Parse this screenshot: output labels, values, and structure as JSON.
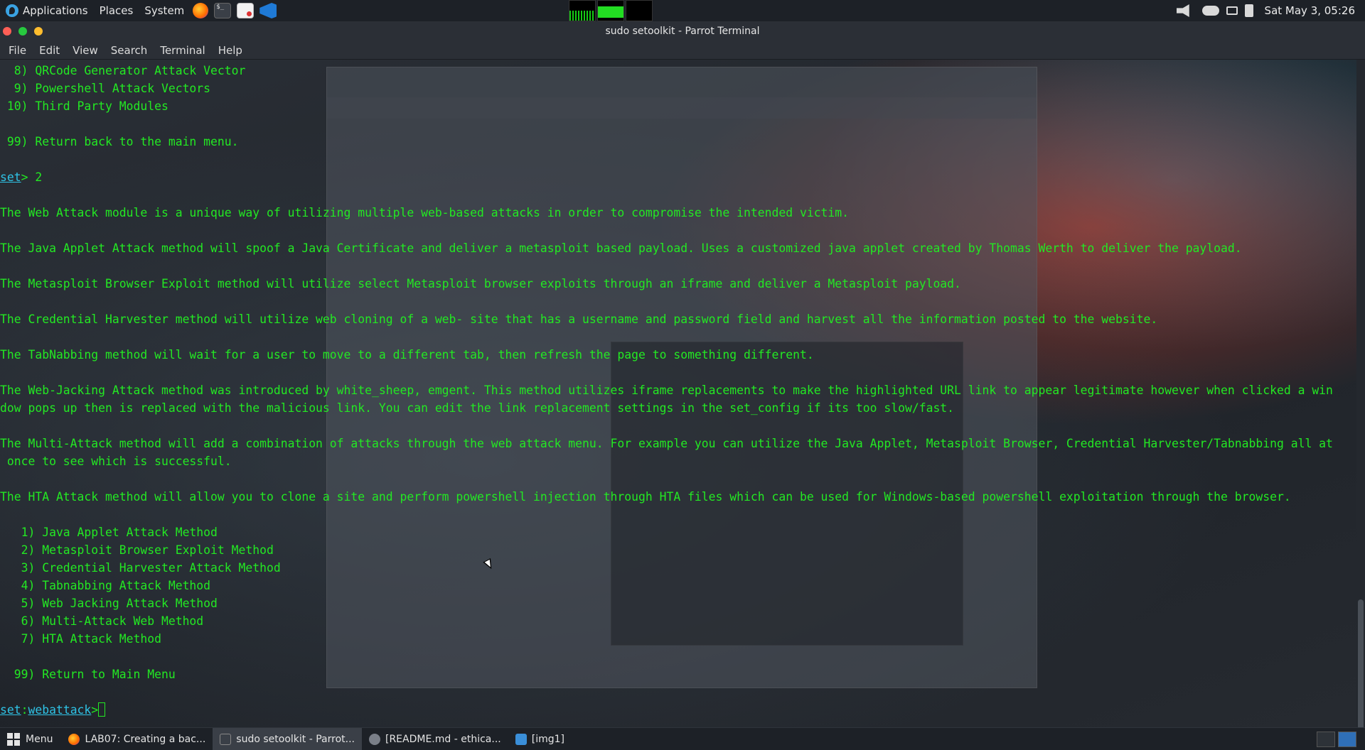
{
  "top_panel": {
    "menus": [
      "Applications",
      "Places",
      "System"
    ],
    "clock": "Sat May  3, 05:26"
  },
  "window": {
    "title": "sudo setoolkit - Parrot Terminal",
    "menu": [
      "File",
      "Edit",
      "View",
      "Search",
      "Terminal",
      "Help"
    ]
  },
  "terminal": {
    "lines": [
      {
        "type": "text",
        "text": "  8) QRCode Generator Attack Vector"
      },
      {
        "type": "text",
        "text": "  9) Powershell Attack Vectors"
      },
      {
        "type": "text",
        "text": " 10) Third Party Modules"
      },
      {
        "type": "blank"
      },
      {
        "type": "text",
        "text": " 99) Return back to the main menu."
      },
      {
        "type": "blank"
      },
      {
        "type": "prompt",
        "set": "set",
        "mid": "",
        "suffix": "> 2"
      },
      {
        "type": "blank"
      },
      {
        "type": "text",
        "text": "The Web Attack module is a unique way of utilizing multiple web-based attacks in order to compromise the intended victim."
      },
      {
        "type": "blank"
      },
      {
        "type": "text",
        "text": "The Java Applet Attack method will spoof a Java Certificate and deliver a metasploit based payload. Uses a customized java applet created by Thomas Werth to deliver the payload."
      },
      {
        "type": "blank"
      },
      {
        "type": "text",
        "text": "The Metasploit Browser Exploit method will utilize select Metasploit browser exploits through an iframe and deliver a Metasploit payload."
      },
      {
        "type": "blank"
      },
      {
        "type": "text",
        "text": "The Credential Harvester method will utilize web cloning of a web- site that has a username and password field and harvest all the information posted to the website."
      },
      {
        "type": "blank"
      },
      {
        "type": "text",
        "text": "The TabNabbing method will wait for a user to move to a different tab, then refresh the page to something different."
      },
      {
        "type": "blank"
      },
      {
        "type": "text",
        "text": "The Web-Jacking Attack method was introduced by white_sheep, emgent. This method utilizes iframe replacements to make the highlighted URL link to appear legitimate however when clicked a win"
      },
      {
        "type": "text",
        "text": "dow pops up then is replaced with the malicious link. You can edit the link replacement settings in the set_config if its too slow/fast."
      },
      {
        "type": "blank"
      },
      {
        "type": "text",
        "text": "The Multi-Attack method will add a combination of attacks through the web attack menu. For example you can utilize the Java Applet, Metasploit Browser, Credential Harvester/Tabnabbing all at"
      },
      {
        "type": "text",
        "text": " once to see which is successful."
      },
      {
        "type": "blank"
      },
      {
        "type": "text",
        "text": "The HTA Attack method will allow you to clone a site and perform powershell injection through HTA files which can be used for Windows-based powershell exploitation through the browser."
      },
      {
        "type": "blank"
      },
      {
        "type": "text",
        "text": "   1) Java Applet Attack Method"
      },
      {
        "type": "text",
        "text": "   2) Metasploit Browser Exploit Method"
      },
      {
        "type": "text",
        "text": "   3) Credential Harvester Attack Method"
      },
      {
        "type": "text",
        "text": "   4) Tabnabbing Attack Method"
      },
      {
        "type": "text",
        "text": "   5) Web Jacking Attack Method"
      },
      {
        "type": "text",
        "text": "   6) Multi-Attack Web Method"
      },
      {
        "type": "text",
        "text": "   7) HTA Attack Method"
      },
      {
        "type": "blank"
      },
      {
        "type": "text",
        "text": "  99) Return to Main Menu"
      },
      {
        "type": "blank"
      },
      {
        "type": "prompt",
        "set": "set",
        "mid": ":",
        "module": "webattack",
        "suffix": ">",
        "cursor": true
      }
    ],
    "colors": {
      "output": "#23e823",
      "prompt": "#2fc3e6"
    }
  },
  "taskbar": {
    "menu_label": "Menu",
    "tasks": [
      {
        "label": "LAB07: Creating a bac...",
        "icon": "firefox-icon",
        "active": false
      },
      {
        "label": "sudo setoolkit - Parrot...",
        "icon": "terminal-icon",
        "active": true
      },
      {
        "label": "[README.md - ethica...",
        "icon": "browser-icon",
        "active": false
      },
      {
        "label": "[img1]",
        "icon": "folder-icon",
        "active": false
      }
    ]
  }
}
